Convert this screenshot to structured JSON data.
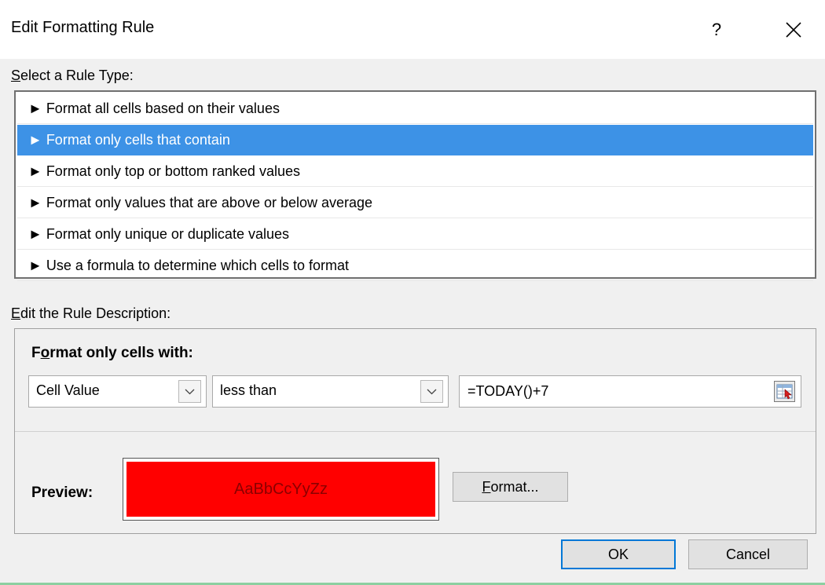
{
  "window": {
    "title": "Edit Formatting Rule",
    "help_glyph": "?",
    "close_icon": "close-icon"
  },
  "rule_type": {
    "label_prefix": "S",
    "label_rest": "elect a Rule Type:",
    "items": [
      {
        "label": "► Format all cells based on their values",
        "selected": false
      },
      {
        "label": "► Format only cells that contain",
        "selected": true
      },
      {
        "label": "► Format only top or bottom ranked values",
        "selected": false
      },
      {
        "label": "► Format only values that are above or below average",
        "selected": false
      },
      {
        "label": "► Format only unique or duplicate values",
        "selected": false
      },
      {
        "label": "► Use a formula to determine which cells to format",
        "selected": false
      }
    ]
  },
  "description": {
    "label_prefix": "E",
    "label_rest": "dit the Rule Description:",
    "heading_prefix": "F",
    "heading_underlined": "o",
    "heading_rest": "rmat only cells with:",
    "condition_field": "Cell Value",
    "operator": "less than",
    "formula": "=TODAY()+7",
    "preview_label": "Preview:",
    "preview_sample": "AaBbCcYyZz",
    "format_button_prefix": "F",
    "format_button_rest": "ormat..."
  },
  "buttons": {
    "ok": "OK",
    "cancel": "Cancel"
  },
  "colors": {
    "selection": "#3d92e6",
    "preview_fill": "#ff0000",
    "preview_text": "#8b0000",
    "default_button_border": "#0078d7"
  }
}
